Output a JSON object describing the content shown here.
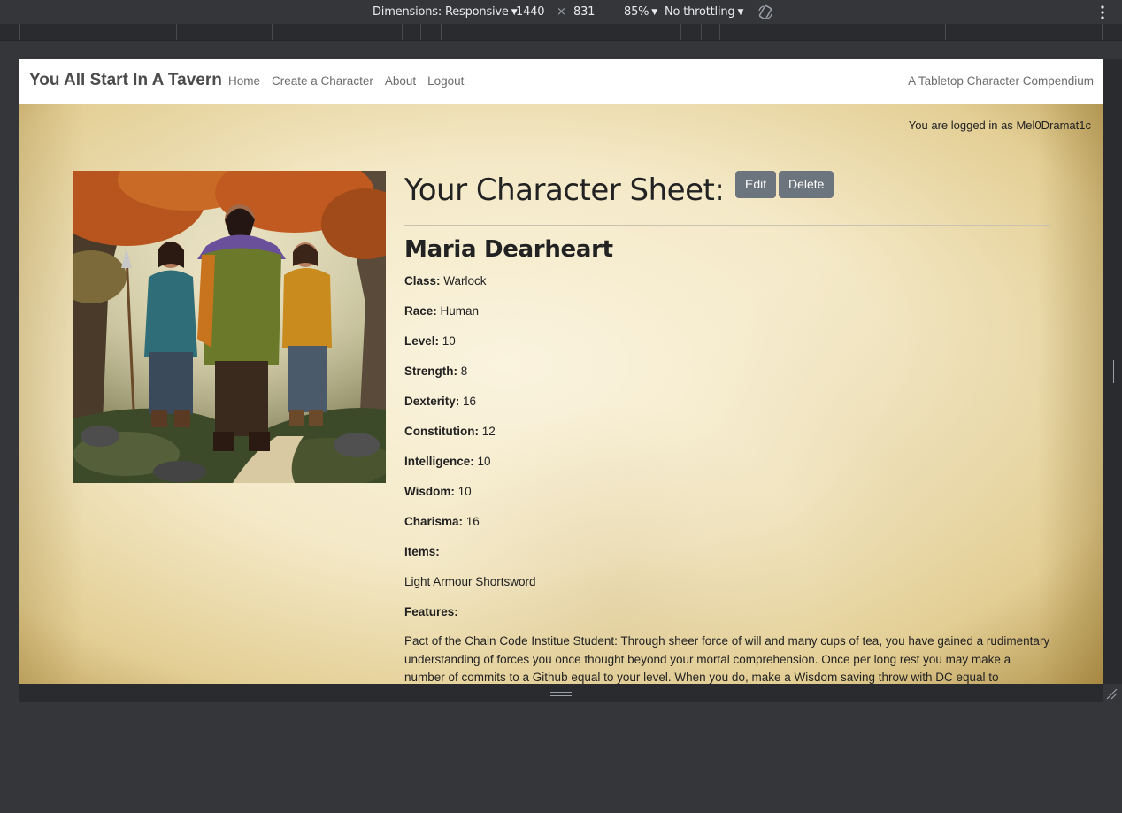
{
  "devtools": {
    "dimensions_label": "Dimensions: Responsive",
    "width": "1440",
    "times": "×",
    "height": "831",
    "zoom": "85%",
    "throttling": "No throttling"
  },
  "navbar": {
    "brand": "You All Start In A Tavern",
    "links": [
      "Home",
      "Create a Character",
      "About",
      "Logout"
    ],
    "tagline": "A Tabletop Character Compendium"
  },
  "session": {
    "logged_in_text": "You are logged in as Mel0Dramat1c"
  },
  "sheet": {
    "title": "Your Character Sheet:",
    "edit_label": "Edit",
    "delete_label": "Delete",
    "character_name": "Maria Dearheart",
    "stats": [
      {
        "label": "Class:",
        "value": "Warlock"
      },
      {
        "label": "Race:",
        "value": "Human"
      },
      {
        "label": "Level:",
        "value": "10"
      },
      {
        "label": "Strength:",
        "value": "8"
      },
      {
        "label": "Dexterity:",
        "value": "16"
      },
      {
        "label": "Constitution:",
        "value": "12"
      },
      {
        "label": "Intelligence:",
        "value": "10"
      },
      {
        "label": "Wisdom:",
        "value": "10"
      },
      {
        "label": "Charisma:",
        "value": "16"
      }
    ],
    "items_label": "Items:",
    "items_text": "Light Armour Shortsword",
    "features_label": "Features:",
    "features_text": "Pact of the Chain Code Institue Student: Through sheer force of will and many cups of tea, you have gained a rudimentary understanding of forces you once thought beyond your mortal comprehension. Once per long rest you may make a number of commits to a Github equal to your level. When you do, make a Wisdom saving throw with DC equal to"
  },
  "colors": {
    "button": "#6c757d",
    "navbar_bg": "#ffffff",
    "devtools_bg": "#35363a"
  },
  "icons": {
    "rotate": "rotate-icon",
    "menu": "kebab-icon"
  }
}
